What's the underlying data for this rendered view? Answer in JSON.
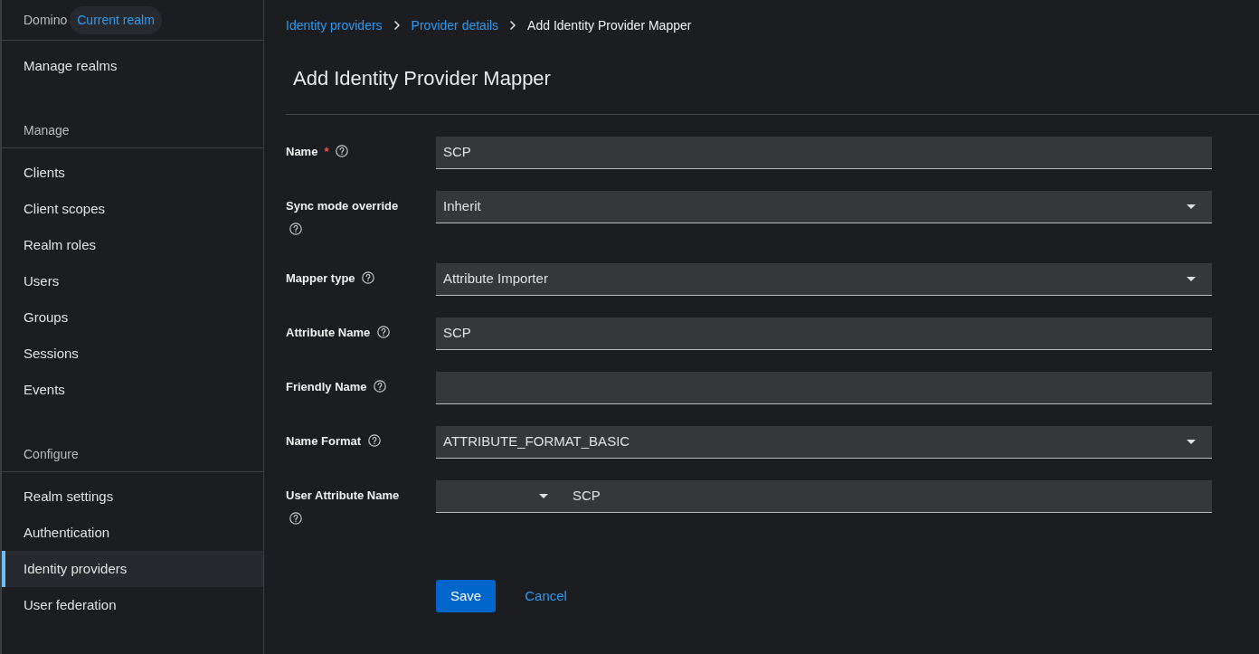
{
  "sidebar": {
    "realm": "Domino",
    "realm_badge": "Current realm",
    "top_items": [
      {
        "label": "Manage realms",
        "selected": false
      }
    ],
    "sections": [
      {
        "title": "Manage",
        "items": [
          {
            "label": "Clients",
            "selected": false
          },
          {
            "label": "Client scopes",
            "selected": false
          },
          {
            "label": "Realm roles",
            "selected": false
          },
          {
            "label": "Users",
            "selected": false
          },
          {
            "label": "Groups",
            "selected": false
          },
          {
            "label": "Sessions",
            "selected": false
          },
          {
            "label": "Events",
            "selected": false
          }
        ]
      },
      {
        "title": "Configure",
        "items": [
          {
            "label": "Realm settings",
            "selected": false
          },
          {
            "label": "Authentication",
            "selected": false
          },
          {
            "label": "Identity providers",
            "selected": true
          },
          {
            "label": "User federation",
            "selected": false
          }
        ]
      }
    ]
  },
  "breadcrumb": [
    {
      "label": "Identity providers",
      "kind": "link"
    },
    {
      "label": "Provider details",
      "kind": "link"
    },
    {
      "label": "Add Identity Provider Mapper",
      "kind": "current"
    }
  ],
  "page_title": "Add Identity Provider Mapper",
  "form": {
    "fields": [
      {
        "label": "Name",
        "required_mark": "*",
        "kind": "text",
        "value": "SCP"
      },
      {
        "label": "Sync mode override",
        "kind": "select",
        "value": "Inherit"
      },
      {
        "label": "Mapper type",
        "kind": "select",
        "value": "Attribute Importer"
      },
      {
        "label": "Attribute Name",
        "kind": "text",
        "value": "SCP"
      },
      {
        "label": "Friendly Name",
        "kind": "text"
      },
      {
        "label": "Name Format",
        "kind": "select",
        "value": "ATTRIBUTE_FORMAT_BASIC"
      },
      {
        "label": "User Attribute Name",
        "kind": "select_text",
        "value": "SCP"
      }
    ]
  },
  "actions": [
    {
      "label": "Save",
      "kind": "primary"
    },
    {
      "label": "Cancel",
      "kind": "link"
    }
  ]
}
